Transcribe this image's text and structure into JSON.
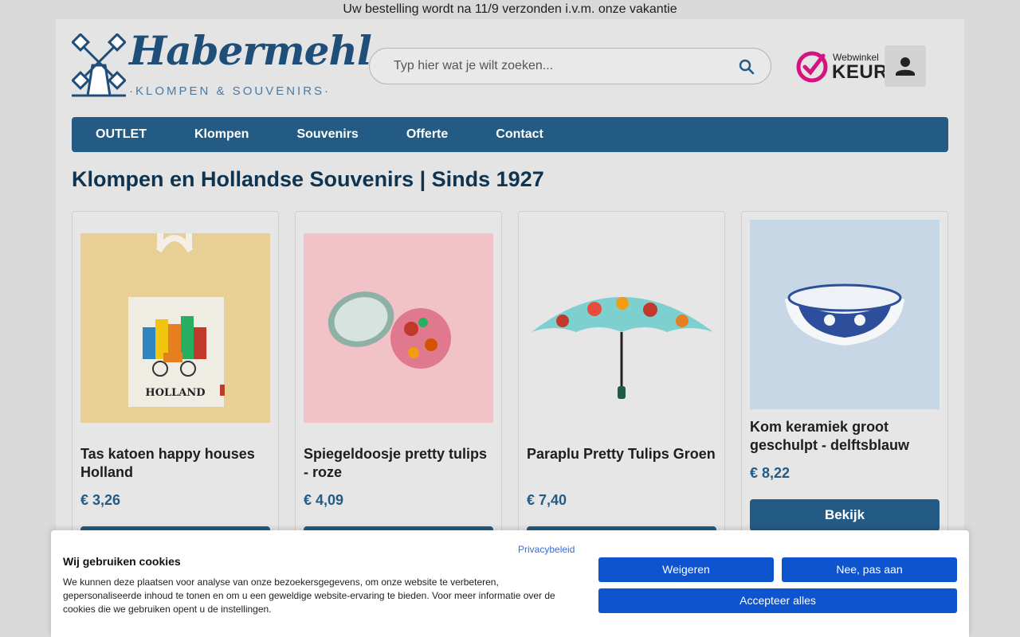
{
  "announcement": "Uw bestelling wordt na 11/9 verzonden i.v.m. onze vakantie",
  "logo": {
    "name": "Habermehl",
    "tagline": "·KLOMPEN & SOUVENIRS·"
  },
  "search": {
    "placeholder": "Typ hier wat je wilt zoeken...",
    "icon": "search-icon"
  },
  "badge": {
    "line1": "Webwinkel",
    "line2": "KEUR",
    "color": "#d6127e"
  },
  "nav": [
    "OUTLET",
    "Klompen",
    "Souvenirs",
    "Offerte",
    "Contact"
  ],
  "page_title": "Klompen en Hollandse Souvenirs | Sinds 1927",
  "products": [
    {
      "name": "Tas katoen happy houses Holland",
      "price": "€ 3,26",
      "image_text": "HOLLAND"
    },
    {
      "name": "Spiegeldoosje pretty tulips - roze",
      "price": "€ 4,09"
    },
    {
      "name": "Paraplu Pretty Tulips Groen",
      "price": "€ 7,40"
    },
    {
      "name": "Kom keramiek groot geschulpt - delftsblauw",
      "price": "€ 8,22",
      "button": "Bekijk"
    }
  ],
  "cookie": {
    "title": "Wij gebruiken cookies",
    "text": "We kunnen deze plaatsen voor analyse van onze bezoekersgegevens, om onze website te verbeteren, gepersonaliseerde inhoud te tonen en om u een geweldige website-ervaring te bieden. Voor meer informatie over de cookies die we gebruiken opent u de instellingen.",
    "privacy_link": "Privacybeleid",
    "reject": "Weigeren",
    "customize": "Nee, pas aan",
    "accept": "Accepteer alles"
  },
  "colors": {
    "primary": "#235b85",
    "cookie_button": "#0e54cf",
    "title": "#0e3450"
  }
}
